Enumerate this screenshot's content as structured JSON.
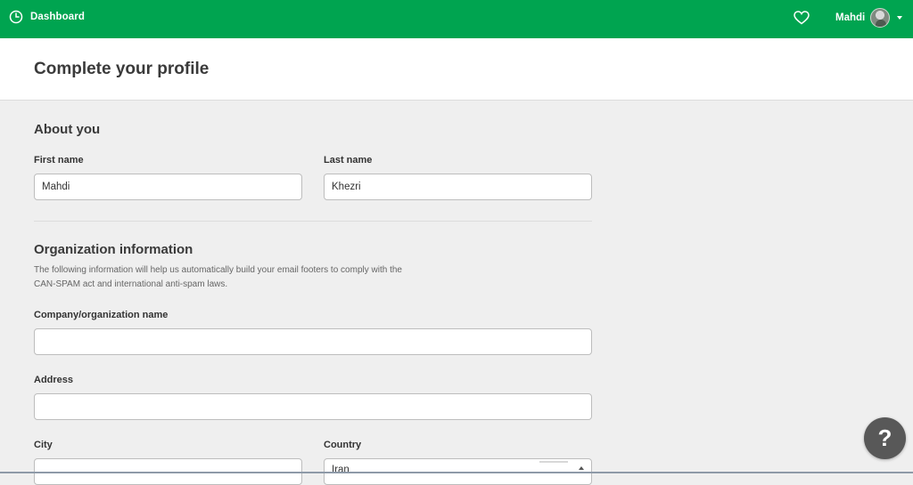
{
  "topbar": {
    "dashboard_label": "Dashboard",
    "dashboard_icon": "clock-icon",
    "favorites_icon": "heart-icon",
    "user_name": "Mahdi",
    "user_caret_icon": "caret-down-icon",
    "bg_color": "#00a450"
  },
  "page": {
    "title": "Complete your profile"
  },
  "about": {
    "title": "About you",
    "first_name_label": "First name",
    "first_name_value": "Mahdi",
    "last_name_label": "Last name",
    "last_name_value": "Khezri"
  },
  "organization": {
    "title": "Organization information",
    "description": "The following information will help us automatically build your email footers to comply with the CAN-SPAM act and international anti-spam laws.",
    "company_label": "Company/organization name",
    "company_value": "",
    "address_label": "Address",
    "address_value": "",
    "city_label": "City",
    "city_value": "",
    "country_label": "Country",
    "country_value": "Iran"
  },
  "help": {
    "label": "?"
  }
}
